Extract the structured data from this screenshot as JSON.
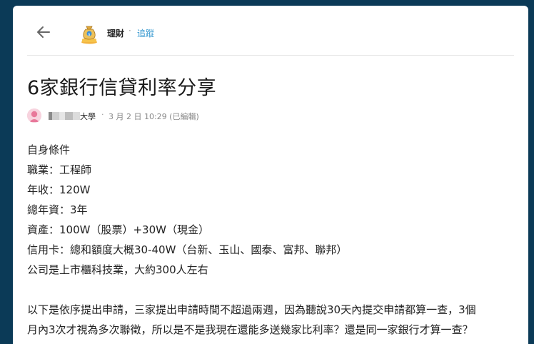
{
  "header": {
    "board_name": "理財",
    "separator": "·",
    "follow_label": "追蹤"
  },
  "post": {
    "title": "6家銀行信貸利率分享",
    "author_school": "大學",
    "meta_separator": "·",
    "timestamp": "3 月 2 日 10:29 (已編輯)",
    "lines": [
      "自身條件",
      "職業：工程師",
      "年收：120W",
      "總年資：3年",
      "資產：100W（股票）+30W（現金）",
      "信用卡：總和額度大概30-40W（台新、玉山、國泰、富邦、聯邦）",
      "公司是上市櫃科技業，大約300人左右"
    ],
    "paragraph2": [
      "以下是依序提出申請，三家提出申請時間不超過兩週，因為聽說30天內提交申請都算一查，3個",
      "月內3次才視為多次聯徵，所以是不是我現在還能多送幾家比利率？還是同一家銀行才算一查？"
    ]
  },
  "colors": {
    "page_background": "#0b3a57",
    "link_blue": "#3397cf",
    "avatar_pink": "#e8789a"
  },
  "icons": {
    "back": "arrow-left-icon",
    "board": "money-bag-icon",
    "avatar": "user-avatar-icon"
  }
}
